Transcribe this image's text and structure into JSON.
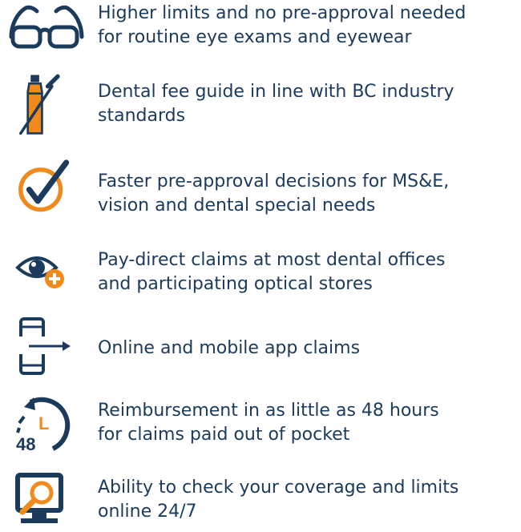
{
  "colors": {
    "navy": "#1b3a5c",
    "orange": "#f08a1c"
  },
  "features": [
    {
      "icon": "glasses-icon",
      "text": "Higher limits and no pre-approval needed\nfor routine eye exams and eyewear"
    },
    {
      "icon": "toothpaste-toothbrush-icon",
      "text": "Dental fee guide in line with BC industry\nstandards"
    },
    {
      "icon": "checkmark-circle-icon",
      "text": "Faster pre-approval decisions for MS&E,\nvision and dental special needs"
    },
    {
      "icon": "eye-plus-icon",
      "text": "Pay-direct claims at most dental offices\nand participating optical stores"
    },
    {
      "icon": "mobile-phone-arrow-icon",
      "text": "Online and mobile app claims"
    },
    {
      "icon": "clock-48-hours-icon",
      "text": "Reimbursement in as little as 48 hours\nfor claims paid out of pocket",
      "badge": "48",
      "badge_letter": "L"
    },
    {
      "icon": "monitor-magnifier-icon",
      "text": "Ability to check your coverage and limits\nonline 24/7"
    }
  ]
}
